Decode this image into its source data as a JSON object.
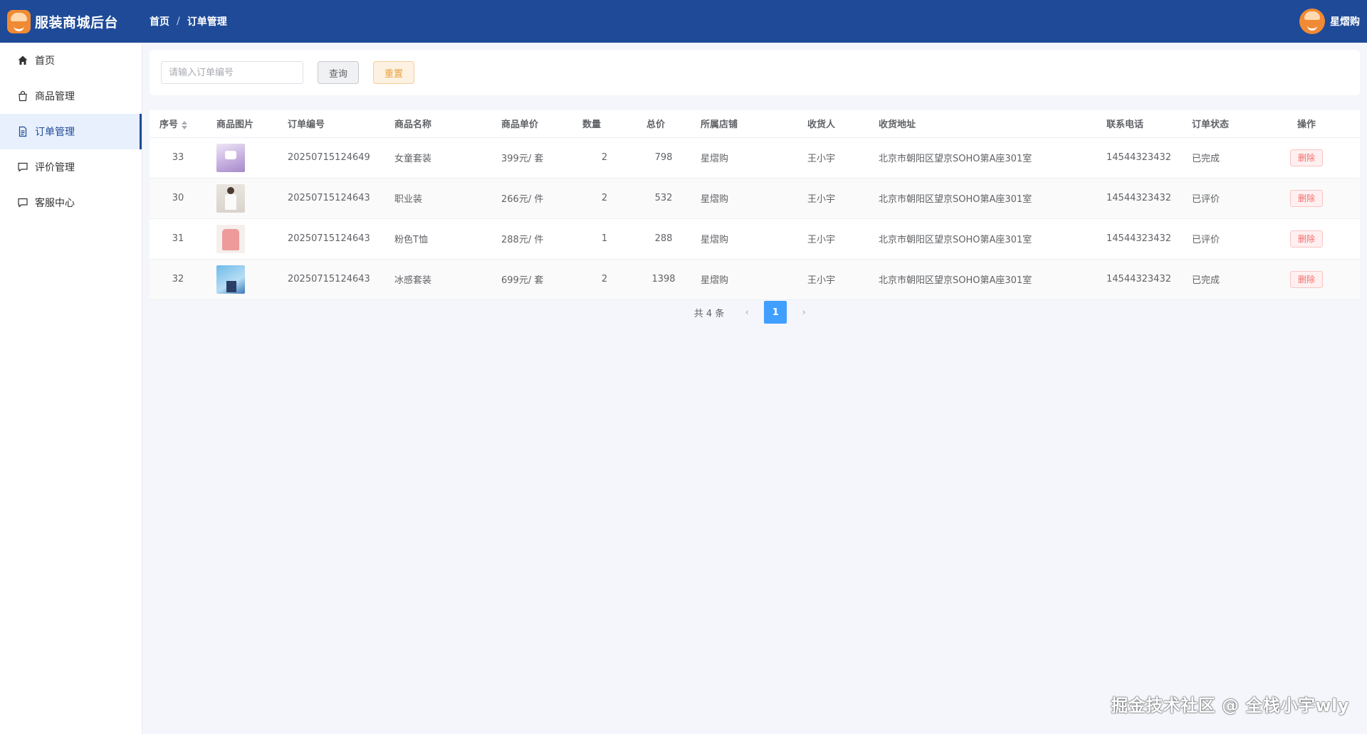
{
  "app": {
    "title": "服装商城后台"
  },
  "breadcrumb": {
    "home": "首页",
    "separator": "/",
    "current": "订单管理"
  },
  "user": {
    "name": "星熠购"
  },
  "sidebar": {
    "items": [
      {
        "label": "首页",
        "icon": "home-icon",
        "active": false
      },
      {
        "label": "商品管理",
        "icon": "shopping-bag-icon",
        "active": false
      },
      {
        "label": "订单管理",
        "icon": "document-icon",
        "active": true
      },
      {
        "label": "评价管理",
        "icon": "chat-bubble-icon",
        "active": false
      },
      {
        "label": "客服中心",
        "icon": "chat-bubble-icon",
        "active": false
      }
    ]
  },
  "search": {
    "placeholder": "请输入订单编号",
    "value": "",
    "query_label": "查询",
    "reset_label": "重置"
  },
  "table": {
    "columns": [
      "序号",
      "商品图片",
      "订单编号",
      "商品名称",
      "商品单价",
      "数量",
      "总价",
      "所属店铺",
      "收货人",
      "收货地址",
      "联系电话",
      "订单状态",
      "操作"
    ],
    "rows": [
      {
        "id": "33",
        "image": "girls-set-thumbnail",
        "order_no": "20250715124649",
        "name": "女童套装",
        "unit_price": "399元/ 套",
        "qty": "2",
        "total": "798",
        "shop": "星熠购",
        "receiver": "王小宇",
        "address": "北京市朝阳区望京SOHO第A座301室",
        "phone": "14544323432",
        "status": "已完成",
        "action": "删除"
      },
      {
        "id": "30",
        "image": "business-suit-thumbnail",
        "order_no": "20250715124643",
        "name": "职业装",
        "unit_price": "266元/ 件",
        "qty": "2",
        "total": "532",
        "shop": "星熠购",
        "receiver": "王小宇",
        "address": "北京市朝阳区望京SOHO第A座301室",
        "phone": "14544323432",
        "status": "已评价",
        "action": "删除"
      },
      {
        "id": "31",
        "image": "pink-tshirt-thumbnail",
        "order_no": "20250715124643",
        "name": "粉色T恤",
        "unit_price": "288元/ 件",
        "qty": "1",
        "total": "288",
        "shop": "星熠购",
        "receiver": "王小宇",
        "address": "北京市朝阳区望京SOHO第A座301室",
        "phone": "14544323432",
        "status": "已评价",
        "action": "删除"
      },
      {
        "id": "32",
        "image": "cool-set-thumbnail",
        "order_no": "20250715124643",
        "name": "冰感套装",
        "unit_price": "699元/ 套",
        "qty": "2",
        "total": "1398",
        "shop": "星熠购",
        "receiver": "王小宇",
        "address": "北京市朝阳区望京SOHO第A座301室",
        "phone": "14544323432",
        "status": "已完成",
        "action": "删除"
      }
    ]
  },
  "pagination": {
    "total_text": "共 4 条",
    "current_page": "1",
    "prev": "‹",
    "next": "›"
  },
  "watermark": "掘金技术社区 @ 全栈小宇wly",
  "colors": {
    "header_bg": "#1e4a98",
    "active_menu_bg": "#e8f0fd",
    "primary": "#409eff",
    "danger": "#f56c6c",
    "warning": "#e6a23c"
  }
}
